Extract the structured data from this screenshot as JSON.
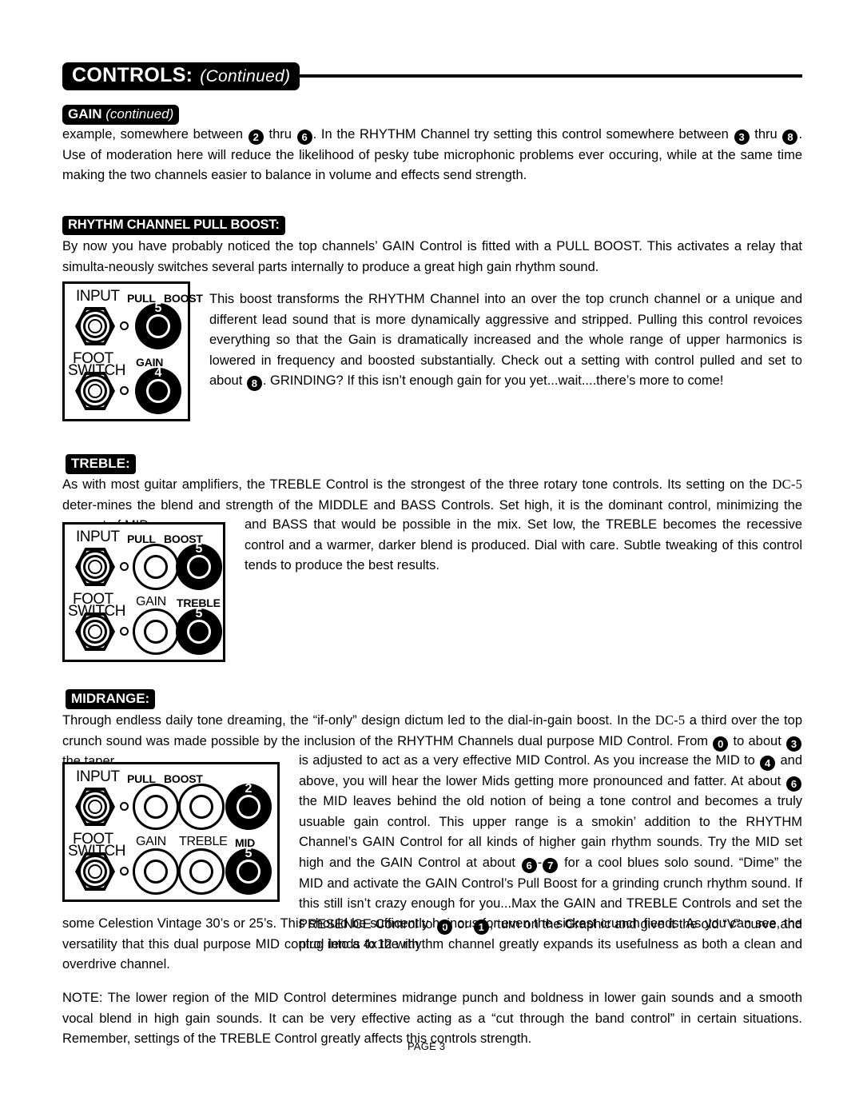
{
  "header": {
    "title": "CONTROLS:",
    "continued": "(Continued)"
  },
  "sections": {
    "gain": {
      "tag_main": "GAIN",
      "tag_italic": "(continued)",
      "body_1": "example, somewhere between",
      "n1": "2",
      "body_2": "thru",
      "n2": "6",
      "body_3": ". In the RHYTHM Channel try setting this control somewhere between",
      "n3": "3",
      "body_4": "thru",
      "n4": "8",
      "body_5": ". Use of moderation here will reduce the likelihood of pesky tube microphonic problems ever occuring, while at the same time making the two channels easier to balance in volume and effects send strength."
    },
    "pull_boost": {
      "tag": "RHYTHM CHANNEL PULL BOOST:",
      "intro": "By now you have probably noticed the top channels’ GAIN Control is fitted with a PULL BOOST. This activates a relay that simulta-neously switches several parts internally to produce a great high gain rhythm sound.",
      "body_1": "This boost transforms the RHYTHM Channel into an over the top crunch channel or a unique and different lead sound that is more dynamically aggressive and stripped. Pulling this control revoices everything so that the Gain is dramatically increased and the whole range of upper harmonics is lowered in frequency and boosted substantially. Check out a setting with control pulled and set to about",
      "n1": "8",
      "body_2": ". GRINDING?  If this isn’t enough gain for you yet...wait....there’s more to come!"
    },
    "treble": {
      "tag": "TREBLE:",
      "body_1": "As with most guitar amplifiers, the TREBLE Control is the strongest of the three rotary tone controls. Its setting on the",
      "model": "DC-5",
      "body_2": "deter-mines the blend and strength of the MIDDLE and BASS Controls. Set high, it is the dominant control, minimizing the amount of MID",
      "body_3": "and BASS that would be possible in the mix. Set low, the TREBLE becomes the recessive control and a warmer, darker blend is produced. Dial with care. Subtle tweaking of this control tends to produce the best results."
    },
    "midrange": {
      "tag": "MIDRANGE:",
      "body_1": "Through endless daily tone dreaming, the “if-only” design dictum led to the dial-in-gain boost. In the",
      "model": "DC-5",
      "body_2": "a third over the top crunch sound was made possible by the inclusion of the RHYTHM Channels dual purpose MID Control. From",
      "n1": "0",
      "body_3": "to about",
      "n2": "3",
      "body_4": "the taper",
      "body_5": "is adjusted to act as a very effective MID Control. As you increase the MID to",
      "n3": "4",
      "body_6": "and above, you will hear the lower Mids getting more pronounced and fatter. At about",
      "n4": "6",
      "body_7": "the MID leaves behind the old notion of being a tone control and becomes a truly usuable gain control.  This upper range is a smokin’ addition to the RHYTHM Channel’s GAIN Control for all kinds of higher gain rhythm sounds. Try the MID set high and the GAIN Control at about",
      "n5": "6",
      "dash": "-",
      "n6": "7",
      "body_8": "for a cool blues solo sound. “Dime” the MID and activate the GAIN Control’s Pull Boost for a grinding crunch rhythm sound. If this still isn’t crazy enough for you...Max the GAIN and TREBLE Controls and set the PRESENCE Control to",
      "n7": "0",
      "body_9": "or",
      "n8": "1",
      "body_10": ", turn on the Graphic and give it the old “V” curve and plug into a 4x12 with",
      "body_11": "some Celestion Vintage 30’s or 25’s.  This should be sufficently heinous for even the sickest crunch fiends. As you can see, the versatility that this dual purpose MID control lends to the rhythm channel greatly expands its usefulness as both a clean and overdrive channel."
    },
    "note": {
      "body": "NOTE:  The lower region of the MID Control determines midrange punch and boldness in lower gain sounds and a smooth vocal blend in high gain sounds. It can be very effective acting as a “cut through the band control” in certain situations. Remember, settings of the TREBLE Control greatly affects this controls strength."
    }
  },
  "panels": {
    "boost": {
      "labels": {
        "input": "INPUT",
        "pull": "PULL",
        "boost": "BOOST",
        "foot": "FOOT",
        "switch": "SWITCH",
        "gain": "GAIN"
      },
      "knobs": [
        {
          "value": "5",
          "style": "black"
        },
        {
          "value": "4",
          "style": "black"
        }
      ]
    },
    "treble": {
      "labels": {
        "input": "INPUT",
        "pull": "PULL",
        "boost": "BOOST",
        "foot": "FOOT",
        "switch": "SWITCH",
        "gain": "GAIN",
        "treble": "TREBLE"
      },
      "knobs": [
        {
          "value": "",
          "style": "white"
        },
        {
          "value": "5",
          "style": "black"
        },
        {
          "value": "",
          "style": "white"
        },
        {
          "value": "5",
          "style": "black"
        }
      ]
    },
    "mid": {
      "labels": {
        "input": "INPUT",
        "pull": "PULL",
        "boost": "BOOST",
        "foot": "FOOT",
        "switch": "SWITCH",
        "gain": "GAIN",
        "treble": "TREBLE",
        "mid": "MID"
      },
      "knobs": [
        {
          "value": "",
          "style": "white"
        },
        {
          "value": "",
          "style": "white"
        },
        {
          "value": "2",
          "style": "black"
        },
        {
          "value": "",
          "style": "white"
        },
        {
          "value": "",
          "style": "white"
        },
        {
          "value": "5",
          "style": "black"
        }
      ]
    }
  },
  "footer": {
    "page": "PAGE 3"
  }
}
